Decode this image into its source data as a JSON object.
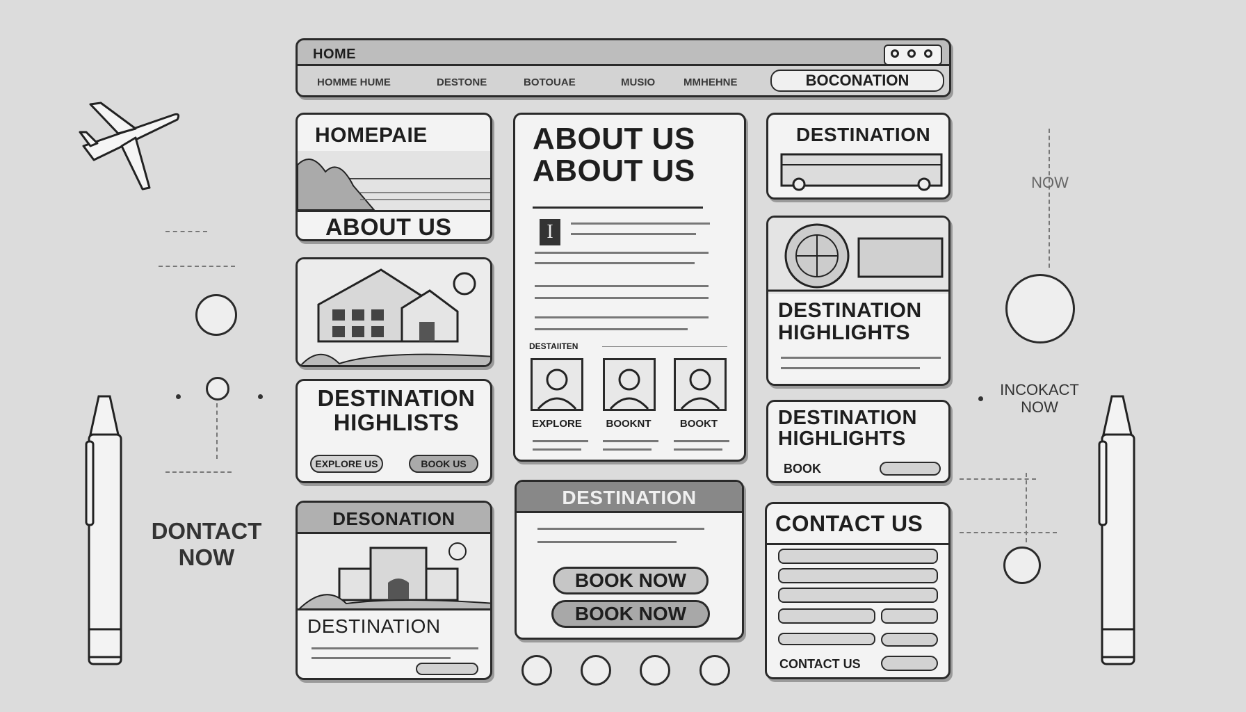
{
  "header": {
    "title": "HOME",
    "nav": [
      "HOMME HUME",
      "DESTONE",
      "BOTOUAE",
      "MUSIO",
      "MMHEHNE"
    ],
    "cta": "BOCONATION"
  },
  "left_column": {
    "card1": {
      "title": "HOMEPAIE",
      "subtitle": "ABOUT US"
    },
    "card3": {
      "title": "DESTINATION HIGHLISTS",
      "btn1": "EXPLORE US",
      "btn2": "BOOK US"
    },
    "card4": {
      "title": "DESONATION",
      "subtitle": "DESTINATION"
    }
  },
  "center_column": {
    "about": {
      "title": "ABOUT US ABOUT US",
      "dropcap": "I",
      "label": "DESTAIITEN",
      "people": [
        {
          "caption": "EXPLORE"
        },
        {
          "caption": "BOOKNT"
        },
        {
          "caption": "BOOKT"
        }
      ]
    },
    "destination": {
      "title": "DESTINATION",
      "btn1": "BOOK NOW",
      "btn2": "BOOK NOW"
    }
  },
  "right_column": {
    "card1": {
      "title": "DESTINATION"
    },
    "card2": {
      "title": "DESTINATION HIGHLIGHTS"
    },
    "card3": {
      "title": "DESTINATION HIGHLIGHTS",
      "btn": "BOOK"
    },
    "contact": {
      "title": "CONTACT US",
      "footer": "CONTACT US"
    }
  },
  "side_text": {
    "left": "DONTACT NOW",
    "right_top": "NOW",
    "right_mid": "INCOKACT NOW"
  },
  "icons": {
    "plane": "airplane-icon",
    "pen": "pen-icon",
    "footer_icons": [
      "social-icon",
      "social-icon",
      "social-icon",
      "social-icon"
    ]
  }
}
